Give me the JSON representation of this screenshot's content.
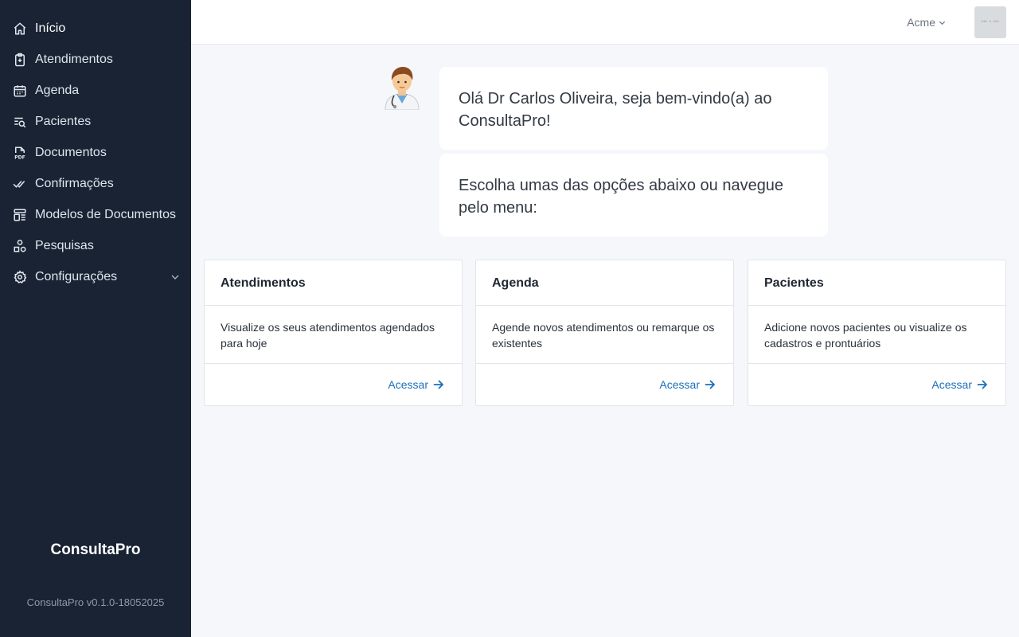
{
  "sidebar": {
    "items": [
      {
        "label": "Início",
        "icon": "home-icon"
      },
      {
        "label": "Atendimentos",
        "icon": "clipboard-icon"
      },
      {
        "label": "Agenda",
        "icon": "calendar-icon"
      },
      {
        "label": "Pacientes",
        "icon": "list-search-icon"
      },
      {
        "label": "Documentos",
        "icon": "pdf-file-icon"
      },
      {
        "label": "Confirmações",
        "icon": "double-check-icon"
      },
      {
        "label": "Modelos de Documentos",
        "icon": "template-icon"
      },
      {
        "label": "Pesquisas",
        "icon": "shapes-icon"
      },
      {
        "label": "Configurações",
        "icon": "gear-icon"
      }
    ],
    "brand": "ConsultaPro",
    "version": "ConsultaPro v0.1.0-18052025"
  },
  "header": {
    "org_name": "Acme",
    "avatar_text": "••• • •••"
  },
  "welcome": {
    "greeting": "Olá Dr Carlos Oliveira, seja bem-vindo(a) ao ConsultaPro!",
    "prompt": "Escolha umas das opções abaixo ou navegue pelo menu:"
  },
  "cards": [
    {
      "title": "Atendimentos",
      "description": "Visualize os seus atendimentos agendados para hoje",
      "action": "Acessar"
    },
    {
      "title": "Agenda",
      "description": "Agende novos atendimentos ou remarque os existentes",
      "action": "Acessar"
    },
    {
      "title": "Pacientes",
      "description": "Adicione novos pacientes ou visualize os cadastros e prontuários",
      "action": "Acessar"
    }
  ],
  "colors": {
    "sidebar_bg": "#192333",
    "page_bg": "#f5f7fb",
    "link": "#1a6fbd"
  }
}
